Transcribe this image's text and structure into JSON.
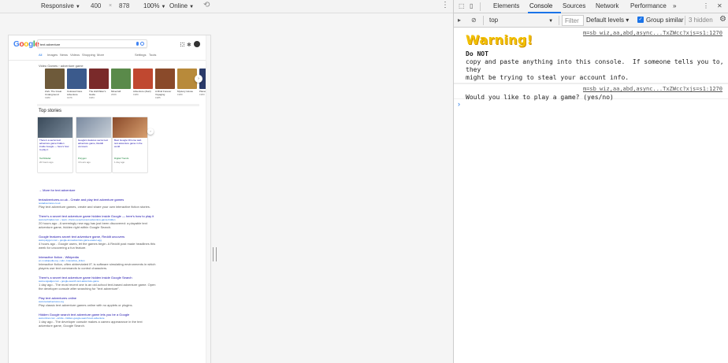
{
  "emulation_bar": {
    "device": "Responsive",
    "width": "400",
    "times": "×",
    "height": "878",
    "zoom": "100%",
    "network": "Online"
  },
  "google": {
    "logo_letters": [
      "G",
      "o",
      "o",
      "g",
      "l",
      "e"
    ],
    "query": "text adventure",
    "tabs": [
      "All",
      "Images",
      "News",
      "Videos",
      "Shopping",
      "More",
      "Settings",
      "Tools"
    ],
    "video_games_title": "Video Games › adventure game",
    "video_games": [
      {
        "name": "Zork: The Great Underground",
        "year": "1980",
        "color": "#6e5a3a"
      },
      {
        "name": "Colossal Cave Adventure",
        "year": "1976",
        "color": "#3b5a8c"
      },
      {
        "name": "The Hitchhiker's Guide",
        "year": "1984",
        "color": "#7a2a2a"
      },
      {
        "name": "Minecraft",
        "year": "2009",
        "color": "#5a8a4a"
      },
      {
        "name": "Adventure (Atari)",
        "year": "1980",
        "color": "#c04830"
      },
      {
        "name": "A Mind Forever Voyaging",
        "year": "1985",
        "color": "#8a4a2a"
      },
      {
        "name": "Mystery House",
        "year": "1980",
        "color": "#b88a3a"
      },
      {
        "name": "Planetfall",
        "year": "1983",
        "color": "#2a3a6a"
      }
    ],
    "top_stories_title": "Top stories",
    "stories": [
      {
        "headline": "There's a secret text adventure game hidden inside Google — here's how to play it",
        "source": "TechRadar",
        "age": "20 hours ago"
      },
      {
        "headline": "Google's features secret text adventure game, Reddit uncovers",
        "source": "Polygon",
        "age": "4 hours ago"
      },
      {
        "headline": "Best Google Chrome web text adventure game in the world",
        "source": "Digital Trends",
        "age": "1 day ago"
      }
    ],
    "more_stories": "→ More for text adventure",
    "results": [
      {
        "title": "textadventures.co.uk - Create and play text adventure games",
        "url": "textadventures.co.uk",
        "snippet": "Play text adventure games, create and share your own interactive fiction stories."
      },
      {
        "title": "There's a secret text adventure game hidden inside Google — here's how to play it",
        "url": "www.techradar.com › news › theres-a-secret-text-adventure-game-hidden",
        "snippet": "20 hours ago - A seemingly new egg has just been discovered: a playable text adventure game, hidden right within Google Search."
      },
      {
        "title": "Google features secret text adventure game, Reddit uncovers",
        "url": "www.polygon.com › google-text-adventure-game-easter-egg",
        "snippet": "4 hours ago - Google users, let the games begin. A Reddit post made headlines this week for uncovering a fun feature."
      },
      {
        "title": "Interactive fiction - Wikipedia",
        "url": "en.m.wikipedia.org › wiki › Interactive_fiction",
        "snippet": "Interactive fiction, often abbreviated IF, is software simulating environments in which players use text commands to control characters."
      },
      {
        "title": "There's a secret text adventure game hidden inside Google Search",
        "url": "www.engadget.com › google-search-text-adventure-game",
        "snippet": "1 day ago - The most recent one is an old-school text-based adventure game. Open the developer console after searching for \"text adventure\"."
      },
      {
        "title": "Play text adventures online",
        "url": "www.textadventures.org",
        "snippet": "Play classic text adventure games online with no applets or plugins."
      },
      {
        "title": "Hidden Google search text adventure game lets you be a Google",
        "url": "www.zdnet.com › article › hidden-google-search-text-adventure",
        "snippet": "1 day ago - The developer console makes a cameo appearance in the text adventure game, Google Search."
      }
    ]
  },
  "devtools": {
    "tabs": [
      "Elements",
      "Console",
      "Sources",
      "Network",
      "Performance",
      "»"
    ],
    "context": "top",
    "filter_placeholder": "Filter",
    "levels": "Default levels ▾",
    "group_similar": "Group similar",
    "hidden_count": "3 hidden",
    "messages": [
      {
        "source": "m=sb_wiz,aa,abd,async...TxZWcc?xjs=s1:1270",
        "big": "Warning!",
        "bold": "Do NOT",
        "text": "copy and paste anything into this console.  If someone tells you to, they\nmight be trying to steal your account info."
      },
      {
        "source": "m=sb_wiz,aa,abd,async...TxZWcc?xjs=s1:1270",
        "text": "Would you like to play a game? (yes/no)"
      }
    ],
    "prompt": "›"
  }
}
